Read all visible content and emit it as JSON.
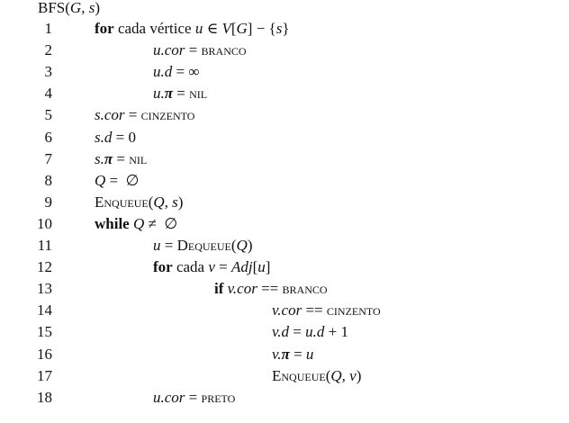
{
  "title": [
    {
      "t": "BFS",
      "s": "rm"
    },
    {
      "t": "(",
      "s": "rm"
    },
    {
      "t": "G",
      "s": "it"
    },
    {
      "t": ", ",
      "s": "rm"
    },
    {
      "t": "s",
      "s": "it"
    },
    {
      "t": ")",
      "s": "rm"
    }
  ],
  "lines": [
    {
      "num": "1",
      "indent": 1,
      "segs": [
        {
          "t": "for",
          "s": "kw"
        },
        {
          "t": " cada vértice ",
          "s": "rm"
        },
        {
          "t": "u",
          "s": "it"
        },
        {
          "t": " ∈ ",
          "s": "rm"
        },
        {
          "t": "V",
          "s": "it"
        },
        {
          "t": "[",
          "s": "rm"
        },
        {
          "t": "G",
          "s": "it"
        },
        {
          "t": "] − {",
          "s": "rm"
        },
        {
          "t": "s",
          "s": "it"
        },
        {
          "t": "}",
          "s": "rm"
        }
      ]
    },
    {
      "num": "2",
      "indent": 2,
      "segs": [
        {
          "t": "u.cor",
          "s": "it"
        },
        {
          "t": " = ",
          "s": "rm"
        },
        {
          "t": "branco",
          "s": "sc"
        }
      ]
    },
    {
      "num": "3",
      "indent": 2,
      "segs": [
        {
          "t": "u.d",
          "s": "it"
        },
        {
          "t": " = ∞",
          "s": "rm"
        }
      ]
    },
    {
      "num": "4",
      "indent": 2,
      "segs": [
        {
          "t": "u.",
          "s": "it"
        },
        {
          "t": "π",
          "s": "bi"
        },
        {
          "t": " = ",
          "s": "rm"
        },
        {
          "t": "nil",
          "s": "sc"
        }
      ]
    },
    {
      "num": "5",
      "indent": 1,
      "segs": [
        {
          "t": "s.cor",
          "s": "it"
        },
        {
          "t": " = ",
          "s": "rm"
        },
        {
          "t": "cinzento",
          "s": "sc"
        }
      ]
    },
    {
      "num": "6",
      "indent": 1,
      "segs": [
        {
          "t": "s.d",
          "s": "it"
        },
        {
          "t": " = 0",
          "s": "rm"
        }
      ]
    },
    {
      "num": "7",
      "indent": 1,
      "segs": [
        {
          "t": "s.",
          "s": "it"
        },
        {
          "t": "π",
          "s": "bi"
        },
        {
          "t": " = ",
          "s": "rm"
        },
        {
          "t": "nil",
          "s": "sc"
        }
      ]
    },
    {
      "num": "8",
      "indent": 1,
      "segs": [
        {
          "t": "Q",
          "s": "it"
        },
        {
          "t": " =  ∅",
          "s": "rm"
        }
      ]
    },
    {
      "num": "9",
      "indent": 1,
      "segs": [
        {
          "t": "Enqueue",
          "s": "sc"
        },
        {
          "t": "(",
          "s": "rm"
        },
        {
          "t": "Q",
          "s": "it"
        },
        {
          "t": ", ",
          "s": "rm"
        },
        {
          "t": "s",
          "s": "it"
        },
        {
          "t": ")",
          "s": "rm"
        }
      ]
    },
    {
      "num": "10",
      "indent": 1,
      "segs": [
        {
          "t": "while",
          "s": "kw"
        },
        {
          "t": " ",
          "s": "rm"
        },
        {
          "t": "Q",
          "s": "it"
        },
        {
          "t": " ≠  ∅",
          "s": "rm"
        }
      ]
    },
    {
      "num": "11",
      "indent": 2,
      "segs": [
        {
          "t": "u",
          "s": "it"
        },
        {
          "t": " = ",
          "s": "rm"
        },
        {
          "t": "Dequeue",
          "s": "sc"
        },
        {
          "t": "(",
          "s": "rm"
        },
        {
          "t": "Q",
          "s": "it"
        },
        {
          "t": ")",
          "s": "rm"
        }
      ]
    },
    {
      "num": "12",
      "indent": 2,
      "segs": [
        {
          "t": "for",
          "s": "kw"
        },
        {
          "t": " cada ",
          "s": "rm"
        },
        {
          "t": "v",
          "s": "it"
        },
        {
          "t": " = ",
          "s": "rm"
        },
        {
          "t": "Adj",
          "s": "it"
        },
        {
          "t": "[",
          "s": "rm"
        },
        {
          "t": "u",
          "s": "it"
        },
        {
          "t": "]",
          "s": "rm"
        }
      ]
    },
    {
      "num": "13",
      "indent": 3,
      "segs": [
        {
          "t": "if",
          "s": "kw"
        },
        {
          "t": " ",
          "s": "rm"
        },
        {
          "t": "v.cor",
          "s": "it"
        },
        {
          "t": " == ",
          "s": "rm"
        },
        {
          "t": "branco",
          "s": "sc"
        }
      ]
    },
    {
      "num": "14",
      "indent": 4,
      "segs": [
        {
          "t": "v.cor",
          "s": "it"
        },
        {
          "t": " == ",
          "s": "rm"
        },
        {
          "t": "cinzento",
          "s": "sc"
        }
      ]
    },
    {
      "num": "15",
      "indent": 4,
      "segs": [
        {
          "t": "v.d",
          "s": "it"
        },
        {
          "t": " = ",
          "s": "rm"
        },
        {
          "t": "u.d",
          "s": "it"
        },
        {
          "t": " + 1",
          "s": "rm"
        }
      ]
    },
    {
      "num": "16",
      "indent": 4,
      "segs": [
        {
          "t": "v.",
          "s": "it"
        },
        {
          "t": "π",
          "s": "bi"
        },
        {
          "t": " = ",
          "s": "rm"
        },
        {
          "t": "u",
          "s": "it"
        }
      ]
    },
    {
      "num": "17",
      "indent": 4,
      "segs": [
        {
          "t": "Enqueue",
          "s": "sc"
        },
        {
          "t": "(",
          "s": "rm"
        },
        {
          "t": "Q",
          "s": "it"
        },
        {
          "t": ", ",
          "s": "rm"
        },
        {
          "t": "v",
          "s": "it"
        },
        {
          "t": ")",
          "s": "rm"
        }
      ]
    },
    {
      "num": "18",
      "indent": 2,
      "segs": [
        {
          "t": "u.cor",
          "s": "it"
        },
        {
          "t": " = ",
          "s": "rm"
        },
        {
          "t": "preto",
          "s": "sc"
        }
      ]
    }
  ]
}
